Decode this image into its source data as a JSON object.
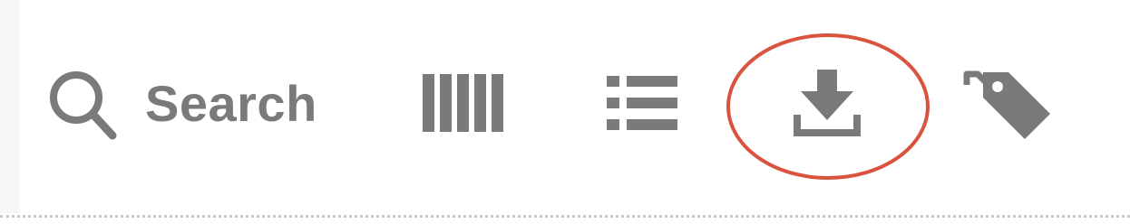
{
  "toolbar": {
    "search": {
      "label": "Search",
      "icon": "search-icon"
    },
    "grid_view": {
      "icon": "grid-view-icon"
    },
    "list_view": {
      "icon": "list-view-icon"
    },
    "download": {
      "icon": "download-icon",
      "highlighted": true
    },
    "tags": {
      "icon": "tags-icon"
    }
  },
  "colors": {
    "icon": "#7a7a7a",
    "highlight": "#d9533e",
    "rule": "#c8c8c8"
  }
}
